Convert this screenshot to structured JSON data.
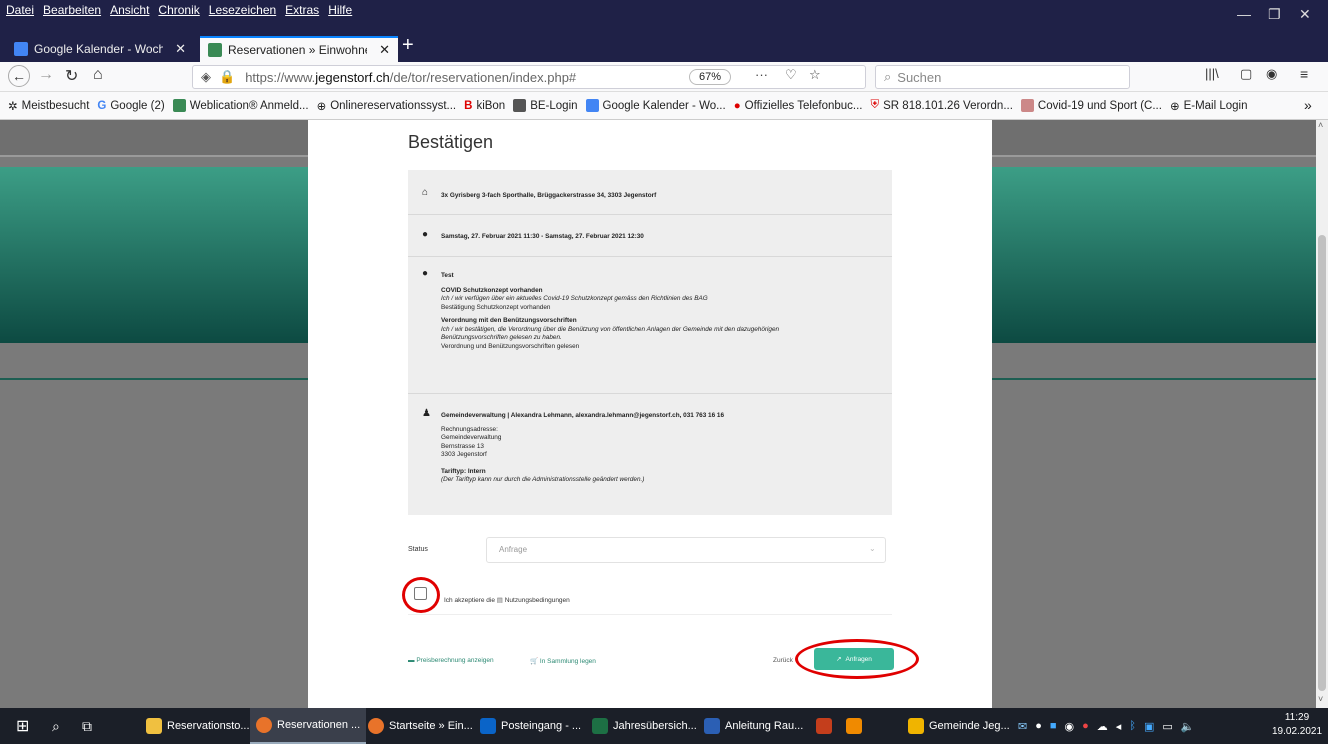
{
  "menubar": {
    "items": [
      "Datei",
      "Bearbeiten",
      "Ansicht",
      "Chronik",
      "Lesezeichen",
      "Extras",
      "Hilfe"
    ]
  },
  "tabs": [
    {
      "label": "Google Kalender - Woche vom"
    },
    {
      "label": "Reservationen » Einwohnergem"
    }
  ],
  "nav": {
    "url_prefix": "https://www.",
    "url_domain": "jegenstorf.ch",
    "url_path": "/de/tor/reservationen/index.php#",
    "zoom": "67%",
    "search_placeholder": "Suchen"
  },
  "bookmarks": [
    "Meistbesucht",
    "Google (2)",
    "Weblication® Anmeld...",
    "Onlinereservationssyst...",
    "kiBon",
    "BE-Login",
    "Google Kalender - Wo...",
    "Offizielles Telefonbuc...",
    "SR 818.101.26 Verordn...",
    "Covid-19 und Sport (C...",
    "E-Mail Login"
  ],
  "page": {
    "title": "Bestätigen",
    "location": "3x Gyrisberg 3-fach Sporthalle, Brüggackerstrasse 34, 3303 Jegenstorf",
    "datetime": "Samstag, 27. Februar 2021 11:30 - Samstag, 27. Februar 2021 12:30",
    "info": {
      "title": "Test",
      "covid_heading": "COVID Schutzkonzept vorhanden",
      "covid_text": "Ich / wir verfügen über ein aktuelles Covid-19 Schutzkonzept gemäss den Richtlinien des BAG",
      "covid_confirm": "Bestätigung Schutzkonzept vorhanden",
      "verordnung_heading": "Verordnung mit den Benützungsvorschriften",
      "verordnung_text1": "Ich / wir bestätigen, die Verordnung über die Benützung von öffentlichen Anlagen der Gemeinde mit den dazugehörigen",
      "verordnung_text2": "Benützungsvorschriften gelesen zu haben.",
      "verordnung_confirm": "Verordnung und Benützungsvorschriften gelesen"
    },
    "contact": {
      "line": "Gemeindeverwaltung | Alexandra Lehmann, alexandra.lehmann@jegenstorf.ch, 031 763 16 16",
      "billing_label": "Rechnungsadresse:",
      "addr1": "Gemeindeverwaltung",
      "addr2": "Bernstrasse 13",
      "addr3": "3303 Jegenstorf",
      "tariff": "Tariftyp: Intern",
      "tariff_note": "(Der Tariftyp kann nur durch die Administrationsstelle geändert werden.)"
    },
    "status_label": "Status",
    "status_value": "Anfrage",
    "terms_prefix": "Ich akzeptiere die",
    "terms_link": "Nutzungsbedingungen",
    "price_link": "Preisberechnung anzeigen",
    "collection_link": "In Sammlung legen",
    "back_label": "Zurück",
    "submit_label": "Anfragen"
  },
  "taskbar": {
    "items": [
      "Reservationsto...",
      "Reservationen ...",
      "Startseite » Ein...",
      "Posteingang - ...",
      "Jahresübersich...",
      "Anleitung Rau...",
      "Gemeinde Jeg..."
    ],
    "time": "11:29",
    "date": "19.02.2021"
  },
  "colors": {
    "teal": "#2d8a74",
    "accent_red": "#e00000",
    "titlebar": "#1f2147"
  }
}
